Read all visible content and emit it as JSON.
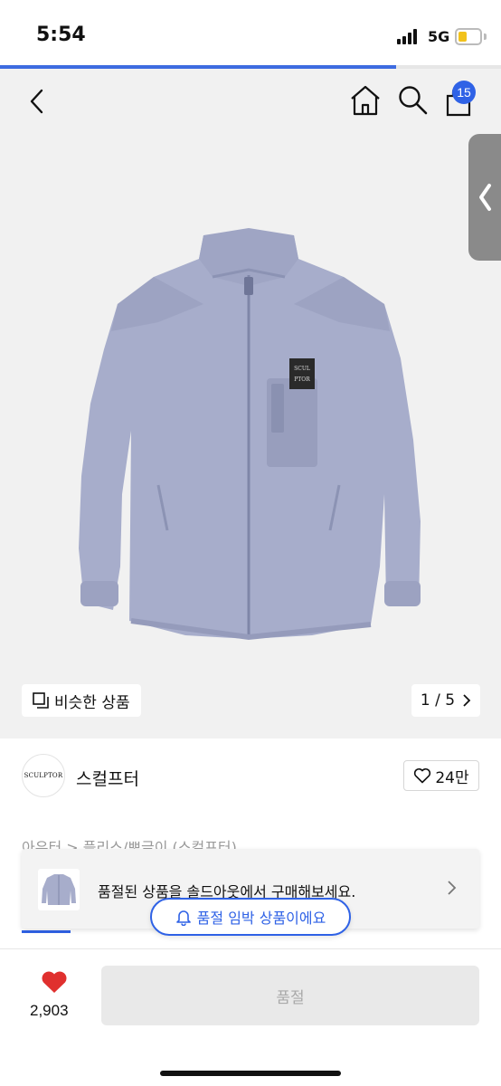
{
  "status_bar": {
    "time": "5:54",
    "network": "5G",
    "load_progress": 0.79
  },
  "nav": {
    "cart_count": "15"
  },
  "gallery": {
    "similar_label": "비슷한 상품",
    "pager": "1 / 5",
    "logo_lines": [
      "SCUL",
      "PTOR"
    ]
  },
  "brand": {
    "logo_text": "SCULPTOR",
    "name": "스컬프터",
    "likes": "24만"
  },
  "category": {
    "path": "아우터 > 플리스/뽀글이 (스컬프터)"
  },
  "soldout_banner": {
    "text": "품절된 상품을 솔드아웃에서 구매해보세요."
  },
  "warning_pill": {
    "label": "품절 임박 상품이에요"
  },
  "bottom_bar": {
    "like_count": "2,903",
    "buy_label": "품절"
  },
  "colors": {
    "accent": "#2f62e6",
    "heart": "#e0302e",
    "jacket": "#a7adcb"
  },
  "icons": [
    "back-icon",
    "home-icon",
    "search-icon",
    "shopping-bag-icon",
    "side-tab-chevron-icon",
    "similar-icon",
    "chevron-right-icon",
    "heart-outline-icon",
    "bell-icon",
    "heart-filled-icon"
  ]
}
